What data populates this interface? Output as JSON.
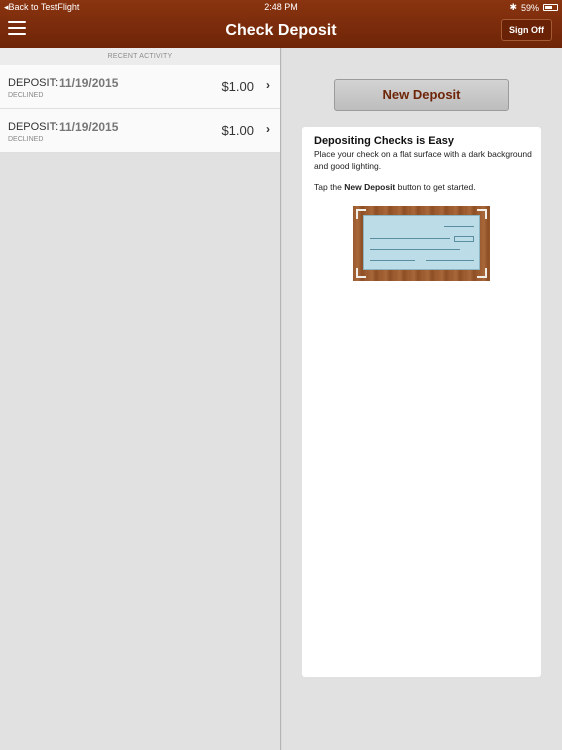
{
  "status_bar": {
    "back_label": "◂Back to TestFlight",
    "time": "2:48 PM",
    "bluetooth": "✱",
    "battery": "59%"
  },
  "nav": {
    "title": "Check Deposit",
    "sign_off": "Sign Off"
  },
  "activity": {
    "section_title": "RECENT ACTIVITY",
    "items": [
      {
        "type": "DEPOSIT:",
        "date": "11/19/2015",
        "status": "DECLINED",
        "amount": "$1.00"
      },
      {
        "type": "DEPOSIT:",
        "date": "11/19/2015",
        "status": "DECLINED",
        "amount": "$1.00"
      }
    ]
  },
  "deposit": {
    "button_label": "New Deposit",
    "info_title": "Depositing Checks is Easy",
    "info_text": "Place your check on a flat surface with a dark background and good lighting.",
    "tip_prefix": "Tap the ",
    "tip_bold": "New Deposit",
    "tip_suffix": " button to get started."
  },
  "colors": {
    "brand": "#7a2c0b",
    "button_text": "#6e2507"
  }
}
